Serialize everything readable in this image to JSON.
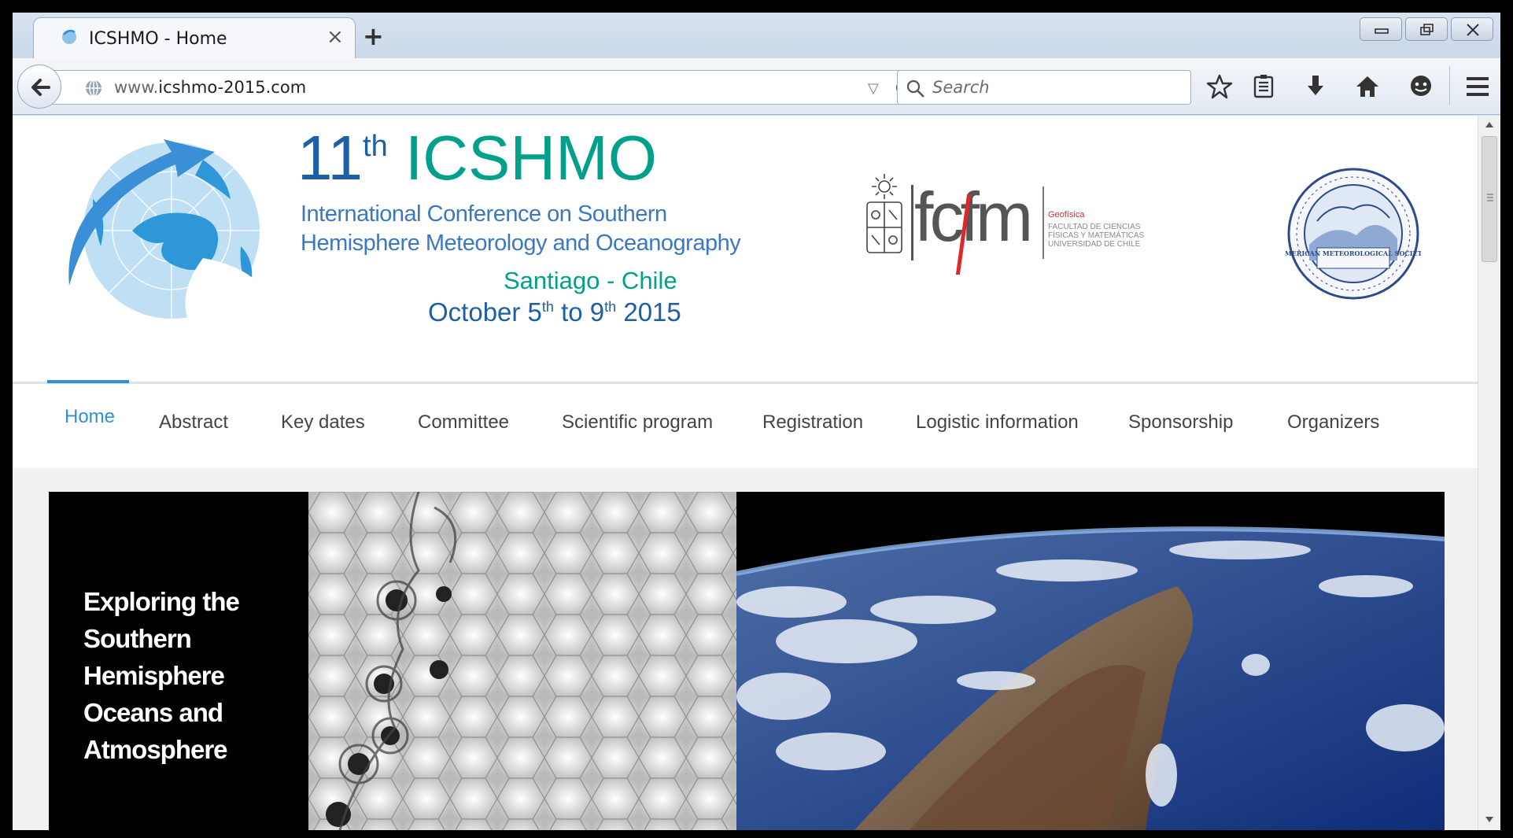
{
  "browser": {
    "tab_title": "ICSHMO - Home",
    "tab_close": "×",
    "new_tab": "+",
    "url_prefix": "www.",
    "url_domain": "icshmo-2015.com",
    "search_placeholder": "Search",
    "icons": [
      "back-arrow-icon",
      "globe-icon",
      "reload-icon",
      "search-icon",
      "star-icon",
      "reading-list-icon",
      "download-icon",
      "home-icon",
      "chat-icon",
      "menu-icon"
    ]
  },
  "header": {
    "title_number": "11",
    "title_sup": "th",
    "title_name": " ICSHMO",
    "subtitle_line1": "International Conference on Southern",
    "subtitle_line2": "Hemisphere Meteorology and Oceanography",
    "location": "Santiago - Chile",
    "dates_pre": "October 5",
    "dates_sup1": "th",
    "dates_mid": " to 9",
    "dates_sup2": "th",
    "dates_post": " 2015",
    "fcfm_logo_text": "fcfm",
    "fcfm_dept": "Geofísica",
    "fcfm_faculty_1": "FACULTAD DE CIENCIAS",
    "fcfm_faculty_2": "FÍSICAS Y MATEMÁTICAS",
    "fcfm_faculty_3": "UNIVERSIDAD DE CHILE",
    "ams_seal_text": "AMERICAN METEOROLOGICAL SOCIETY"
  },
  "menu": {
    "items": [
      "Home",
      "Abstract",
      "Key dates",
      "Committee",
      "Scientific program",
      "Registration",
      "Logistic information",
      "Sponsorship",
      "Organizers"
    ],
    "active": "Home"
  },
  "banner": {
    "line1": "Exploring the",
    "line2": "Southern",
    "line3": "Hemisphere",
    "line4": "Oceans and",
    "line5": "Atmosphere"
  },
  "colors": {
    "accent_blue": "#2f8fd8",
    "title_teal": "#00a08a",
    "title_blue": "#1d5fa6",
    "fcfm_red": "#e0262c"
  }
}
